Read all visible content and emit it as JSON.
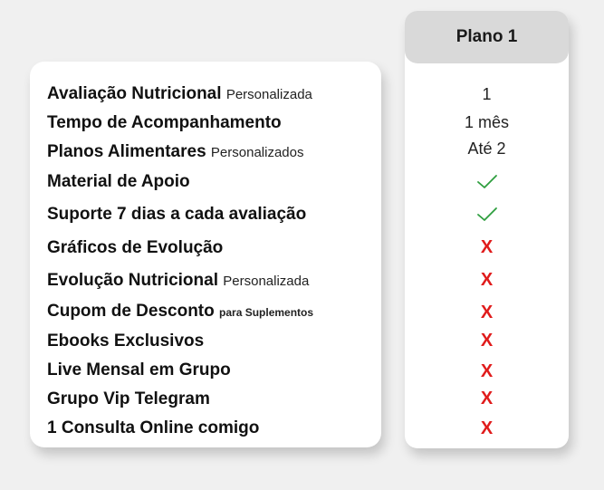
{
  "plan": {
    "title": "Plano 1"
  },
  "rows": [
    {
      "feature": "Avaliação Nutricional",
      "detail": "Personalizada",
      "value": "1"
    },
    {
      "feature": "Tempo de Acompanhamento",
      "detail": "",
      "value": "1 mês"
    },
    {
      "feature": "Planos Alimentares",
      "detail": "Personalizados",
      "value": "Até 2"
    },
    {
      "feature": "Material de Apoio",
      "detail": "",
      "value": "check-icon"
    },
    {
      "feature": "Suporte 7 dias a cada avaliação",
      "detail": "",
      "value": "check-icon"
    },
    {
      "feature": "Gráficos de Evolução",
      "detail": "",
      "value": "X"
    },
    {
      "feature": "Evolução Nutricional",
      "detail": "Personalizada",
      "value": "X"
    },
    {
      "feature": "Cupom de Desconto",
      "detail": "para Suplementos",
      "value": "X"
    },
    {
      "feature": "Ebooks Exclusivos",
      "detail": "",
      "value": "X"
    },
    {
      "feature": "Live Mensal em Grupo",
      "detail": "",
      "value": "X"
    },
    {
      "feature": "Grupo Vip Telegram",
      "detail": "",
      "value": "X"
    },
    {
      "feature": "1 Consulta Online comigo",
      "detail": "",
      "value": "X"
    }
  ],
  "colors": {
    "check": "#2e9e3e",
    "cross": "#e01b1b",
    "header_bg": "#d9d9d9",
    "page_bg": "#f0f0f0"
  }
}
